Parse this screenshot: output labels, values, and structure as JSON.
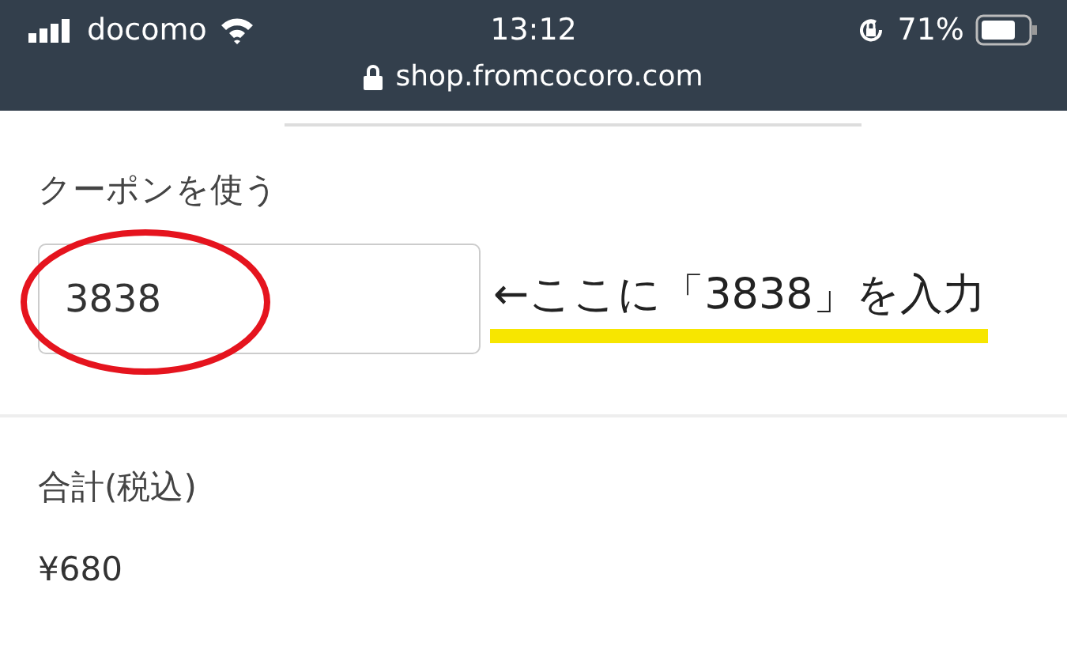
{
  "status_bar": {
    "carrier": "docomo",
    "time": "13:12",
    "battery": "71%"
  },
  "address_bar": {
    "url": "shop.fromcocoro.com"
  },
  "coupon": {
    "label": "クーポンを使う",
    "value": "3838",
    "annotation": "←ここに「3838」を入力"
  },
  "total": {
    "label": "合計(税込)",
    "value": "¥680"
  }
}
